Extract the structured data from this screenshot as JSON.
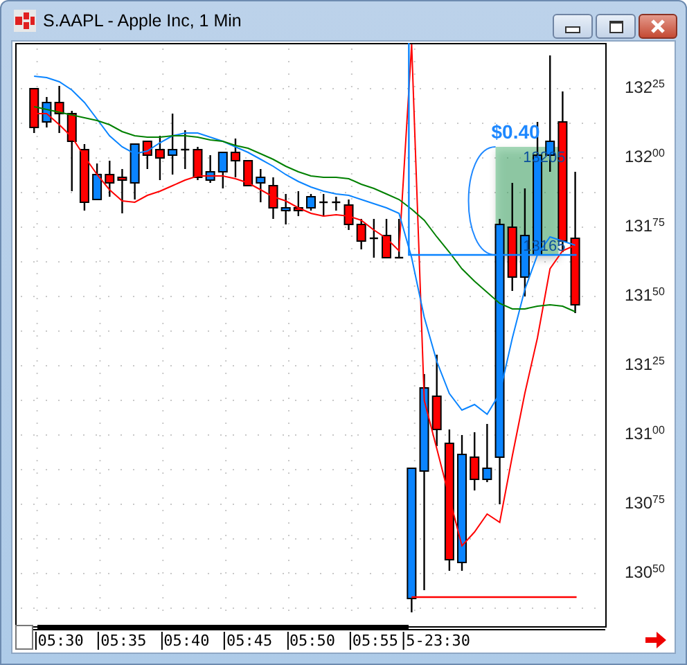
{
  "window": {
    "title": "S.AAPL - Apple Inc, 1 Min"
  },
  "chart": {
    "chart_data": {
      "type": "candlestick",
      "ylim": [
        13030.5,
        13241.5
      ],
      "yticks": [
        13225,
        13200,
        13175,
        13150,
        13125,
        13100,
        13075,
        13050
      ],
      "grid": true,
      "categories": [
        null,
        null,
        null,
        "05:30",
        null,
        null,
        null,
        null,
        "05:35",
        null,
        null,
        null,
        null,
        "05:40",
        null,
        null,
        null,
        null,
        "05:45",
        null,
        null,
        null,
        null,
        "05:50",
        null,
        null,
        null,
        null,
        "05:55",
        null,
        null,
        null,
        null,
        "5-23:30",
        null,
        null,
        null,
        null,
        null,
        null,
        null,
        null,
        null,
        null,
        null,
        null,
        null
      ],
      "ohlc": [
        null,
        [
          13225,
          13225,
          13209,
          13211
        ],
        [
          13213,
          13222,
          13211,
          13220
        ],
        [
          13220,
          13226,
          13209,
          13216
        ],
        [
          13216,
          13217,
          13188,
          13206
        ],
        [
          13203,
          13205,
          13181,
          13184
        ],
        [
          13185,
          13198,
          13185,
          13194
        ],
        [
          13194,
          13199,
          13186,
          13191
        ],
        [
          13193,
          13196,
          13180,
          13192
        ],
        [
          13191,
          13205,
          13185,
          13205
        ],
        [
          13206,
          13206,
          13196,
          13201
        ],
        [
          13203,
          13208,
          13192,
          13200
        ],
        [
          13201,
          13216,
          13194,
          13203
        ],
        [
          13203,
          13210,
          13196,
          13203
        ],
        [
          13203,
          13204,
          13192,
          13193
        ],
        [
          13192,
          13201,
          13191,
          13195
        ],
        [
          13195,
          13202,
          13189,
          13202
        ],
        [
          13202,
          13207,
          13193,
          13199
        ],
        [
          13199,
          13199,
          13190,
          13190
        ],
        [
          13191,
          13196,
          13184,
          13193
        ],
        [
          13190,
          13193,
          13178,
          13182
        ],
        [
          13181,
          13187,
          13176,
          13182
        ],
        [
          13182,
          13188,
          13179,
          13181
        ],
        [
          13182,
          13187,
          13181,
          13186
        ],
        [
          13184,
          13187,
          13179,
          13184
        ],
        [
          13184,
          13186,
          13181,
          13184
        ],
        [
          13183,
          13185,
          13174,
          13176
        ],
        [
          13176,
          13178,
          13167,
          13170
        ],
        [
          13171,
          13178,
          13164,
          13171
        ],
        [
          13172,
          13178,
          13164,
          13164
        ],
        [
          13164,
          13178,
          13164,
          13164
        ],
        [
          13041,
          13088,
          13036,
          13088
        ],
        [
          13087,
          13122,
          13044,
          13117
        ],
        [
          13114,
          13129,
          13096,
          13102
        ],
        [
          13097,
          13102,
          13051,
          13055
        ],
        [
          13054,
          13100,
          13051,
          13093
        ],
        [
          13092,
          13101,
          13080,
          13084
        ],
        [
          13084,
          13104,
          13083,
          13088
        ],
        [
          13092,
          13178,
          13075,
          13176
        ],
        [
          13175,
          13191,
          13152,
          13157
        ],
        [
          13157,
          13189,
          13150,
          13172
        ],
        [
          13165,
          13213,
          13165,
          13201
        ],
        [
          13201,
          13237,
          13195,
          13206
        ],
        [
          13213,
          13224,
          13166,
          13170
        ],
        [
          13171,
          13195,
          13144,
          13147
        ],
        null,
        null
      ],
      "series": [
        {
          "type": "line",
          "color": "#ff0000",
          "values": [
            null,
            13216,
            13216,
            13212,
            13207.5,
            13200.5,
            13194,
            13188.5,
            13184.5,
            13184,
            13186.5,
            13188,
            13190,
            13192,
            13193.5,
            13193.5,
            13193.5,
            13192.5,
            13191,
            13188.5,
            13186,
            13184.5,
            13182,
            13180,
            13179,
            13179.5,
            13179,
            13177.5,
            13174,
            13171,
            13166.5,
            13241,
            13112.5,
            13095,
            13077.5,
            13060,
            13065,
            13071.5,
            13068.5,
            13092.5,
            13115,
            13135,
            13160,
            13166.5,
            13168.5,
            null,
            null
          ]
        },
        {
          "type": "line",
          "color": "#0a84ff",
          "values": [
            null,
            13229.5,
            13229,
            13227.5,
            13224.5,
            13220,
            13214,
            13208,
            13204,
            13201.5,
            13202.5,
            13205.5,
            13208,
            13209,
            13209,
            13207.5,
            13206,
            13204,
            13202,
            13199.5,
            13197,
            13194,
            13191.5,
            13189.5,
            13188,
            13187,
            13186.5,
            13185,
            13183.5,
            13182,
            13180,
            13164,
            13142.5,
            13126.5,
            13115,
            13109,
            13111,
            13107.5,
            13115,
            13135,
            13152.5,
            13165,
            13171.5,
            13170,
            13168.5,
            null,
            null
          ]
        },
        {
          "type": "line",
          "color": "#008000",
          "values": [
            null,
            13218.5,
            13217.5,
            13216.5,
            13215.5,
            13214.5,
            13213.5,
            13212,
            13209.5,
            13208,
            13207.5,
            13207.5,
            13208,
            13208,
            13207.5,
            13206.5,
            13206,
            13204.5,
            13203.5,
            13201.5,
            13199.5,
            13197,
            13195,
            13193.5,
            13193,
            13193,
            13192.5,
            13190.5,
            13189,
            13187,
            13185,
            13181.5,
            13177.5,
            13171.5,
            13166,
            13160,
            13155.5,
            13151.5,
            13147.5,
            13145.5,
            13145.5,
            13146.5,
            13147,
            13146.5,
            13144.5,
            null,
            null
          ]
        }
      ],
      "ref_lines": [
        {
          "axis": "y",
          "value": 13165,
          "color": "#0a84ff"
        },
        {
          "axis": "y",
          "value": 13041.5,
          "color": "#ff0000"
        }
      ],
      "bands": [
        {
          "axis": "y",
          "from": 13165,
          "to": 13204,
          "color": "#3caa64"
        }
      ],
      "annotations": [
        {
          "text": "$0.40",
          "y": 13204
        },
        {
          "text": "13205",
          "y": 13204
        },
        {
          "text": "13165",
          "y": 13165
        }
      ]
    }
  }
}
